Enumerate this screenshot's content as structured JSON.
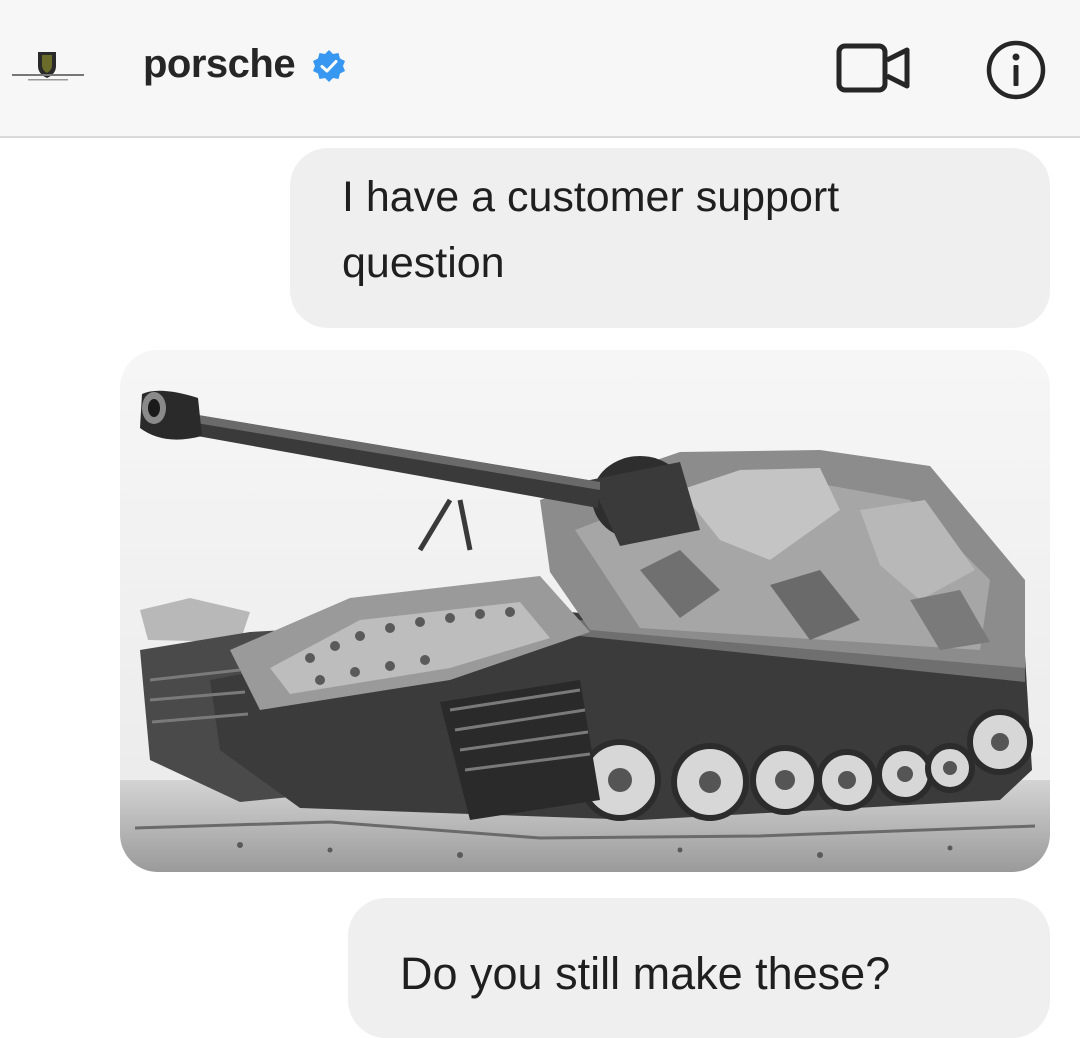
{
  "header": {
    "username": "porsche",
    "verified": true,
    "icons": {
      "avatar": "porsche-crest-avatar",
      "verified": "verified-badge-icon",
      "video": "video-call-icon",
      "info": "info-icon"
    },
    "colors": {
      "verified_badge": "#3897f0",
      "header_bg": "#f7f7f7"
    }
  },
  "messages": [
    {
      "type": "text",
      "text": "I have a customer support question"
    },
    {
      "type": "image",
      "subject": "tank photograph"
    },
    {
      "type": "text",
      "text": "Do you still make these?"
    }
  ],
  "colors": {
    "bubble_bg": "#efefef",
    "text": "#1f1f1f"
  }
}
